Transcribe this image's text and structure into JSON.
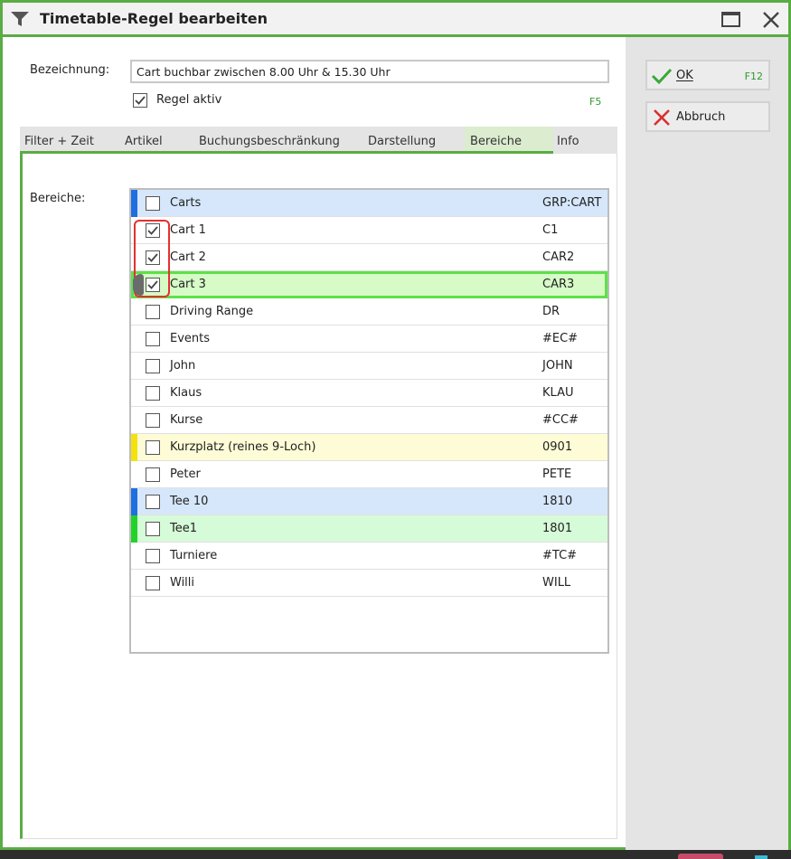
{
  "window": {
    "title": "Timetable-Regel bearbeiten",
    "accent": "#5aac44",
    "title_icon": "funnel-icon",
    "maximize_icon": "maximize-icon",
    "close_icon": "close-icon"
  },
  "form": {
    "name_label": "Bezeichnung:",
    "name_value": "Cart buchbar zwischen 8.00 Uhr & 15.30 Uhr",
    "active_label": "Regel aktiv",
    "active_checked": true,
    "active_hotkey": "F5"
  },
  "actions": {
    "ok_label": "OK",
    "ok_hotkey": "F12",
    "ok_icon": "checkmark-icon",
    "cancel_label": "Abbruch",
    "cancel_icon": "x-icon"
  },
  "tabs": [
    {
      "label": "Filter + Zeit",
      "active": false
    },
    {
      "label": "Artikel",
      "active": false
    },
    {
      "label": "Buchungsbeschränkung",
      "active": false
    },
    {
      "label": "Darstellung",
      "active": false
    },
    {
      "label": "Bereiche",
      "active": true
    },
    {
      "label": "Info",
      "active": false
    }
  ],
  "areas": {
    "label": "Bereiche:",
    "rows": [
      {
        "name": "Carts",
        "code": "GRP:CART",
        "checked": false,
        "bar": "#1f6fe0",
        "bg": "#d6e7fb",
        "selected": false
      },
      {
        "name": "Cart 1",
        "code": "C1",
        "checked": true,
        "bar": "",
        "bg": "#ffffff",
        "selected": false
      },
      {
        "name": "Cart 2",
        "code": "CAR2",
        "checked": true,
        "bar": "",
        "bg": "#ffffff",
        "selected": false
      },
      {
        "name": "Cart 3",
        "code": "CAR3",
        "checked": true,
        "bar": "",
        "bg": "#d6fbc6",
        "selected": true
      },
      {
        "name": "Driving Range",
        "code": "DR",
        "checked": false,
        "bar": "",
        "bg": "#ffffff",
        "selected": false
      },
      {
        "name": "Events",
        "code": "#EC#",
        "checked": false,
        "bar": "",
        "bg": "#ffffff",
        "selected": false
      },
      {
        "name": "John",
        "code": "JOHN",
        "checked": false,
        "bar": "",
        "bg": "#ffffff",
        "selected": false
      },
      {
        "name": "Klaus",
        "code": "KLAU",
        "checked": false,
        "bar": "",
        "bg": "#ffffff",
        "selected": false
      },
      {
        "name": "Kurse",
        "code": "#CC#",
        "checked": false,
        "bar": "",
        "bg": "#ffffff",
        "selected": false
      },
      {
        "name": "Kurzplatz (reines 9-Loch)",
        "code": "0901",
        "checked": false,
        "bar": "#f4e20f",
        "bg": "#fdfcd6",
        "selected": false
      },
      {
        "name": "Peter",
        "code": "PETE",
        "checked": false,
        "bar": "",
        "bg": "#ffffff",
        "selected": false
      },
      {
        "name": "Tee 10",
        "code": "1810",
        "checked": false,
        "bar": "#1f6fe0",
        "bg": "#d6e7fb",
        "selected": false
      },
      {
        "name": "Tee1",
        "code": "1801",
        "checked": false,
        "bar": "#22d22a",
        "bg": "#d6fbd8",
        "selected": false
      },
      {
        "name": "Turniere",
        "code": "#TC#",
        "checked": false,
        "bar": "",
        "bg": "#ffffff",
        "selected": false
      },
      {
        "name": "Willi",
        "code": "WILL",
        "checked": false,
        "bar": "",
        "bg": "#ffffff",
        "selected": false
      }
    ]
  }
}
